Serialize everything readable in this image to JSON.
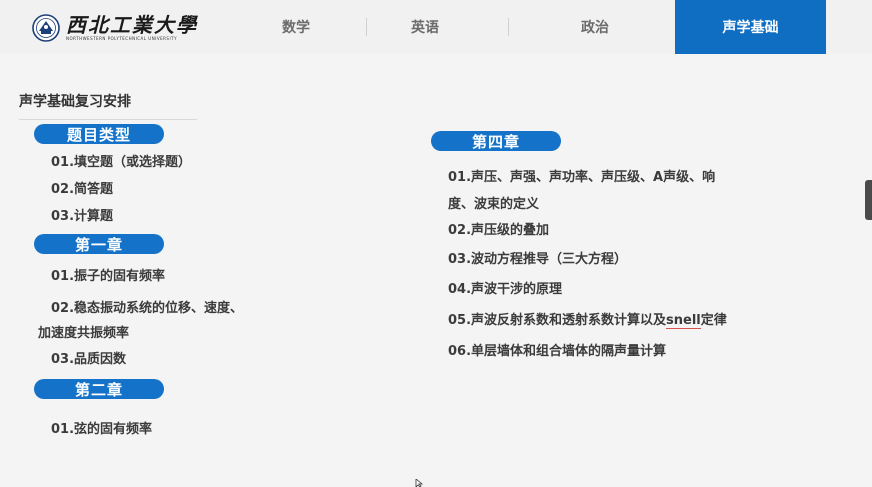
{
  "logo": {
    "cn": "西北工業大學",
    "en": "NORTHWESTERN POLYTECHNICAL UNIVERSITY"
  },
  "nav": {
    "tabs": [
      {
        "label": "数学",
        "active": false
      },
      {
        "label": "英语",
        "active": false
      },
      {
        "label": "政治",
        "active": false
      },
      {
        "label": "声学基础",
        "active": true
      }
    ]
  },
  "page": {
    "title": "声学基础复习安排"
  },
  "left": {
    "sections": [
      {
        "heading": "题目类型",
        "items": [
          "01.填空题（或选择题）",
          "02.简答题",
          "03.计算题"
        ]
      },
      {
        "heading": "第一章",
        "items": [
          "01.振子的固有频率",
          "02.稳态振动系统的位移、速度、",
          "加速度共振频率",
          "03.品质因数"
        ]
      },
      {
        "heading": "第二章",
        "items": [
          "01.弦的固有频率"
        ]
      }
    ]
  },
  "right": {
    "heading": "第四章",
    "items": [
      "01.声压、声强、声功率、声压级、A声级、响",
      "度、波束的定义",
      "02.声压级的叠加",
      "03.波动方程推导（三大方程）",
      "04.声波干涉的原理",
      "05.声波反射系数和透射系数计算以及",
      "snell",
      "定律",
      "06.单层墙体和组合墙体的隔声量计算"
    ]
  },
  "colors": {
    "accent": "#0f6ec2",
    "pill": "#1473c8",
    "text": "#3b3b3b"
  }
}
